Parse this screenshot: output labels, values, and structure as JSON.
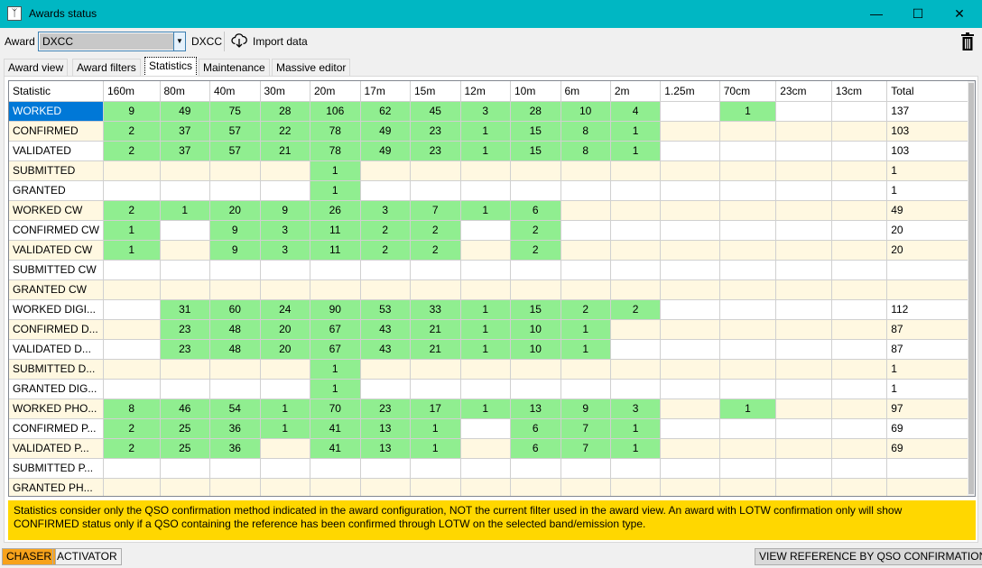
{
  "window": {
    "title": "Awards status",
    "controls": {
      "minimize": "—",
      "maximize": "☐",
      "close": "✕"
    }
  },
  "toolbar": {
    "award_label": "Award",
    "award_value": "DXCC",
    "award_name": "DXCC",
    "import_label": "Import data",
    "icons": {
      "import": "cloud-download-icon",
      "delete": "trash-icon"
    }
  },
  "tabs": [
    {
      "label": "Award view",
      "active": false
    },
    {
      "label": "Award filters",
      "active": false
    },
    {
      "label": "Statistics",
      "active": true
    },
    {
      "label": "Maintenance",
      "active": false
    },
    {
      "label": "Massive editor",
      "active": false
    }
  ],
  "table": {
    "headers": [
      "Statistic",
      "160m",
      "80m",
      "40m",
      "30m",
      "20m",
      "17m",
      "15m",
      "12m",
      "10m",
      "6m",
      "2m",
      "1.25m",
      "70cm",
      "23cm",
      "13cm",
      "Total"
    ],
    "rows": [
      {
        "label": "WORKED",
        "cells": [
          "9",
          "49",
          "75",
          "28",
          "106",
          "62",
          "45",
          "3",
          "28",
          "10",
          "4",
          "",
          "1",
          "",
          ""
        ],
        "total": "137"
      },
      {
        "label": "CONFIRMED",
        "cells": [
          "2",
          "37",
          "57",
          "22",
          "78",
          "49",
          "23",
          "1",
          "15",
          "8",
          "1",
          "",
          "",
          "",
          ""
        ],
        "total": "103"
      },
      {
        "label": "VALIDATED",
        "cells": [
          "2",
          "37",
          "57",
          "21",
          "78",
          "49",
          "23",
          "1",
          "15",
          "8",
          "1",
          "",
          "",
          "",
          ""
        ],
        "total": "103"
      },
      {
        "label": "SUBMITTED",
        "cells": [
          "",
          "",
          "",
          "",
          "1",
          "",
          "",
          "",
          "",
          "",
          "",
          "",
          "",
          "",
          ""
        ],
        "total": "1"
      },
      {
        "label": "GRANTED",
        "cells": [
          "",
          "",
          "",
          "",
          "1",
          "",
          "",
          "",
          "",
          "",
          "",
          "",
          "",
          "",
          ""
        ],
        "total": "1"
      },
      {
        "label": "WORKED CW",
        "cells": [
          "2",
          "1",
          "20",
          "9",
          "26",
          "3",
          "7",
          "1",
          "6",
          "",
          "",
          "",
          "",
          "",
          ""
        ],
        "total": "49"
      },
      {
        "label": "CONFIRMED CW",
        "cells": [
          "1",
          "",
          "9",
          "3",
          "11",
          "2",
          "2",
          "",
          "2",
          "",
          "",
          "",
          "",
          "",
          ""
        ],
        "total": "20"
      },
      {
        "label": "VALIDATED CW",
        "cells": [
          "1",
          "",
          "9",
          "3",
          "11",
          "2",
          "2",
          "",
          "2",
          "",
          "",
          "",
          "",
          "",
          ""
        ],
        "total": "20"
      },
      {
        "label": "SUBMITTED CW",
        "cells": [
          "",
          "",
          "",
          "",
          "",
          "",
          "",
          "",
          "",
          "",
          "",
          "",
          "",
          "",
          ""
        ],
        "total": ""
      },
      {
        "label": "GRANTED CW",
        "cells": [
          "",
          "",
          "",
          "",
          "",
          "",
          "",
          "",
          "",
          "",
          "",
          "",
          "",
          "",
          ""
        ],
        "total": ""
      },
      {
        "label": "WORKED DIGI...",
        "cells": [
          "",
          "31",
          "60",
          "24",
          "90",
          "53",
          "33",
          "1",
          "15",
          "2",
          "2",
          "",
          "",
          "",
          ""
        ],
        "total": "112"
      },
      {
        "label": "CONFIRMED D...",
        "cells": [
          "",
          "23",
          "48",
          "20",
          "67",
          "43",
          "21",
          "1",
          "10",
          "1",
          "",
          "",
          "",
          "",
          ""
        ],
        "total": "87"
      },
      {
        "label": "VALIDATED D...",
        "cells": [
          "",
          "23",
          "48",
          "20",
          "67",
          "43",
          "21",
          "1",
          "10",
          "1",
          "",
          "",
          "",
          "",
          ""
        ],
        "total": "87"
      },
      {
        "label": "SUBMITTED D...",
        "cells": [
          "",
          "",
          "",
          "",
          "1",
          "",
          "",
          "",
          "",
          "",
          "",
          "",
          "",
          "",
          ""
        ],
        "total": "1"
      },
      {
        "label": "GRANTED DIG...",
        "cells": [
          "",
          "",
          "",
          "",
          "1",
          "",
          "",
          "",
          "",
          "",
          "",
          "",
          "",
          "",
          ""
        ],
        "total": "1"
      },
      {
        "label": "WORKED PHO...",
        "cells": [
          "8",
          "46",
          "54",
          "1",
          "70",
          "23",
          "17",
          "1",
          "13",
          "9",
          "3",
          "",
          "1",
          "",
          ""
        ],
        "total": "97"
      },
      {
        "label": "CONFIRMED P...",
        "cells": [
          "2",
          "25",
          "36",
          "1",
          "41",
          "13",
          "1",
          "",
          "6",
          "7",
          "1",
          "",
          "",
          "",
          ""
        ],
        "total": "69"
      },
      {
        "label": "VALIDATED P...",
        "cells": [
          "2",
          "25",
          "36",
          "",
          "41",
          "13",
          "1",
          "",
          "6",
          "7",
          "1",
          "",
          "",
          "",
          ""
        ],
        "total": "69"
      },
      {
        "label": "SUBMITTED P...",
        "cells": [
          "",
          "",
          "",
          "",
          "",
          "",
          "",
          "",
          "",
          "",
          "",
          "",
          "",
          "",
          ""
        ],
        "total": ""
      },
      {
        "label": "GRANTED PH...",
        "cells": [
          "",
          "",
          "",
          "",
          "",
          "",
          "",
          "",
          "",
          "",
          "",
          "",
          "",
          "",
          ""
        ],
        "total": ""
      }
    ]
  },
  "info_text": "Statistics consider only the QSO confirmation method indicated in the award configuration, NOT the current filter used in the award view. An award with LOTW confirmation only will show CONFIRMED status only if a QSO containing the reference has been confirmed through LOTW on the selected band/emission type.",
  "status": {
    "chaser": "CHASER",
    "activator": "ACTIVATOR",
    "view_reference": "VIEW REFERENCE BY QSO CONFIRMATION"
  },
  "colors": {
    "titlebar": "#00b7c3",
    "filled_cell": "#90ee90",
    "alt_row": "#fff8e1",
    "selected": "#0078d7",
    "info_bg": "#ffd700",
    "chaser_bg": "#f7a21b",
    "status_btn_bg": "#d9d9d9"
  }
}
